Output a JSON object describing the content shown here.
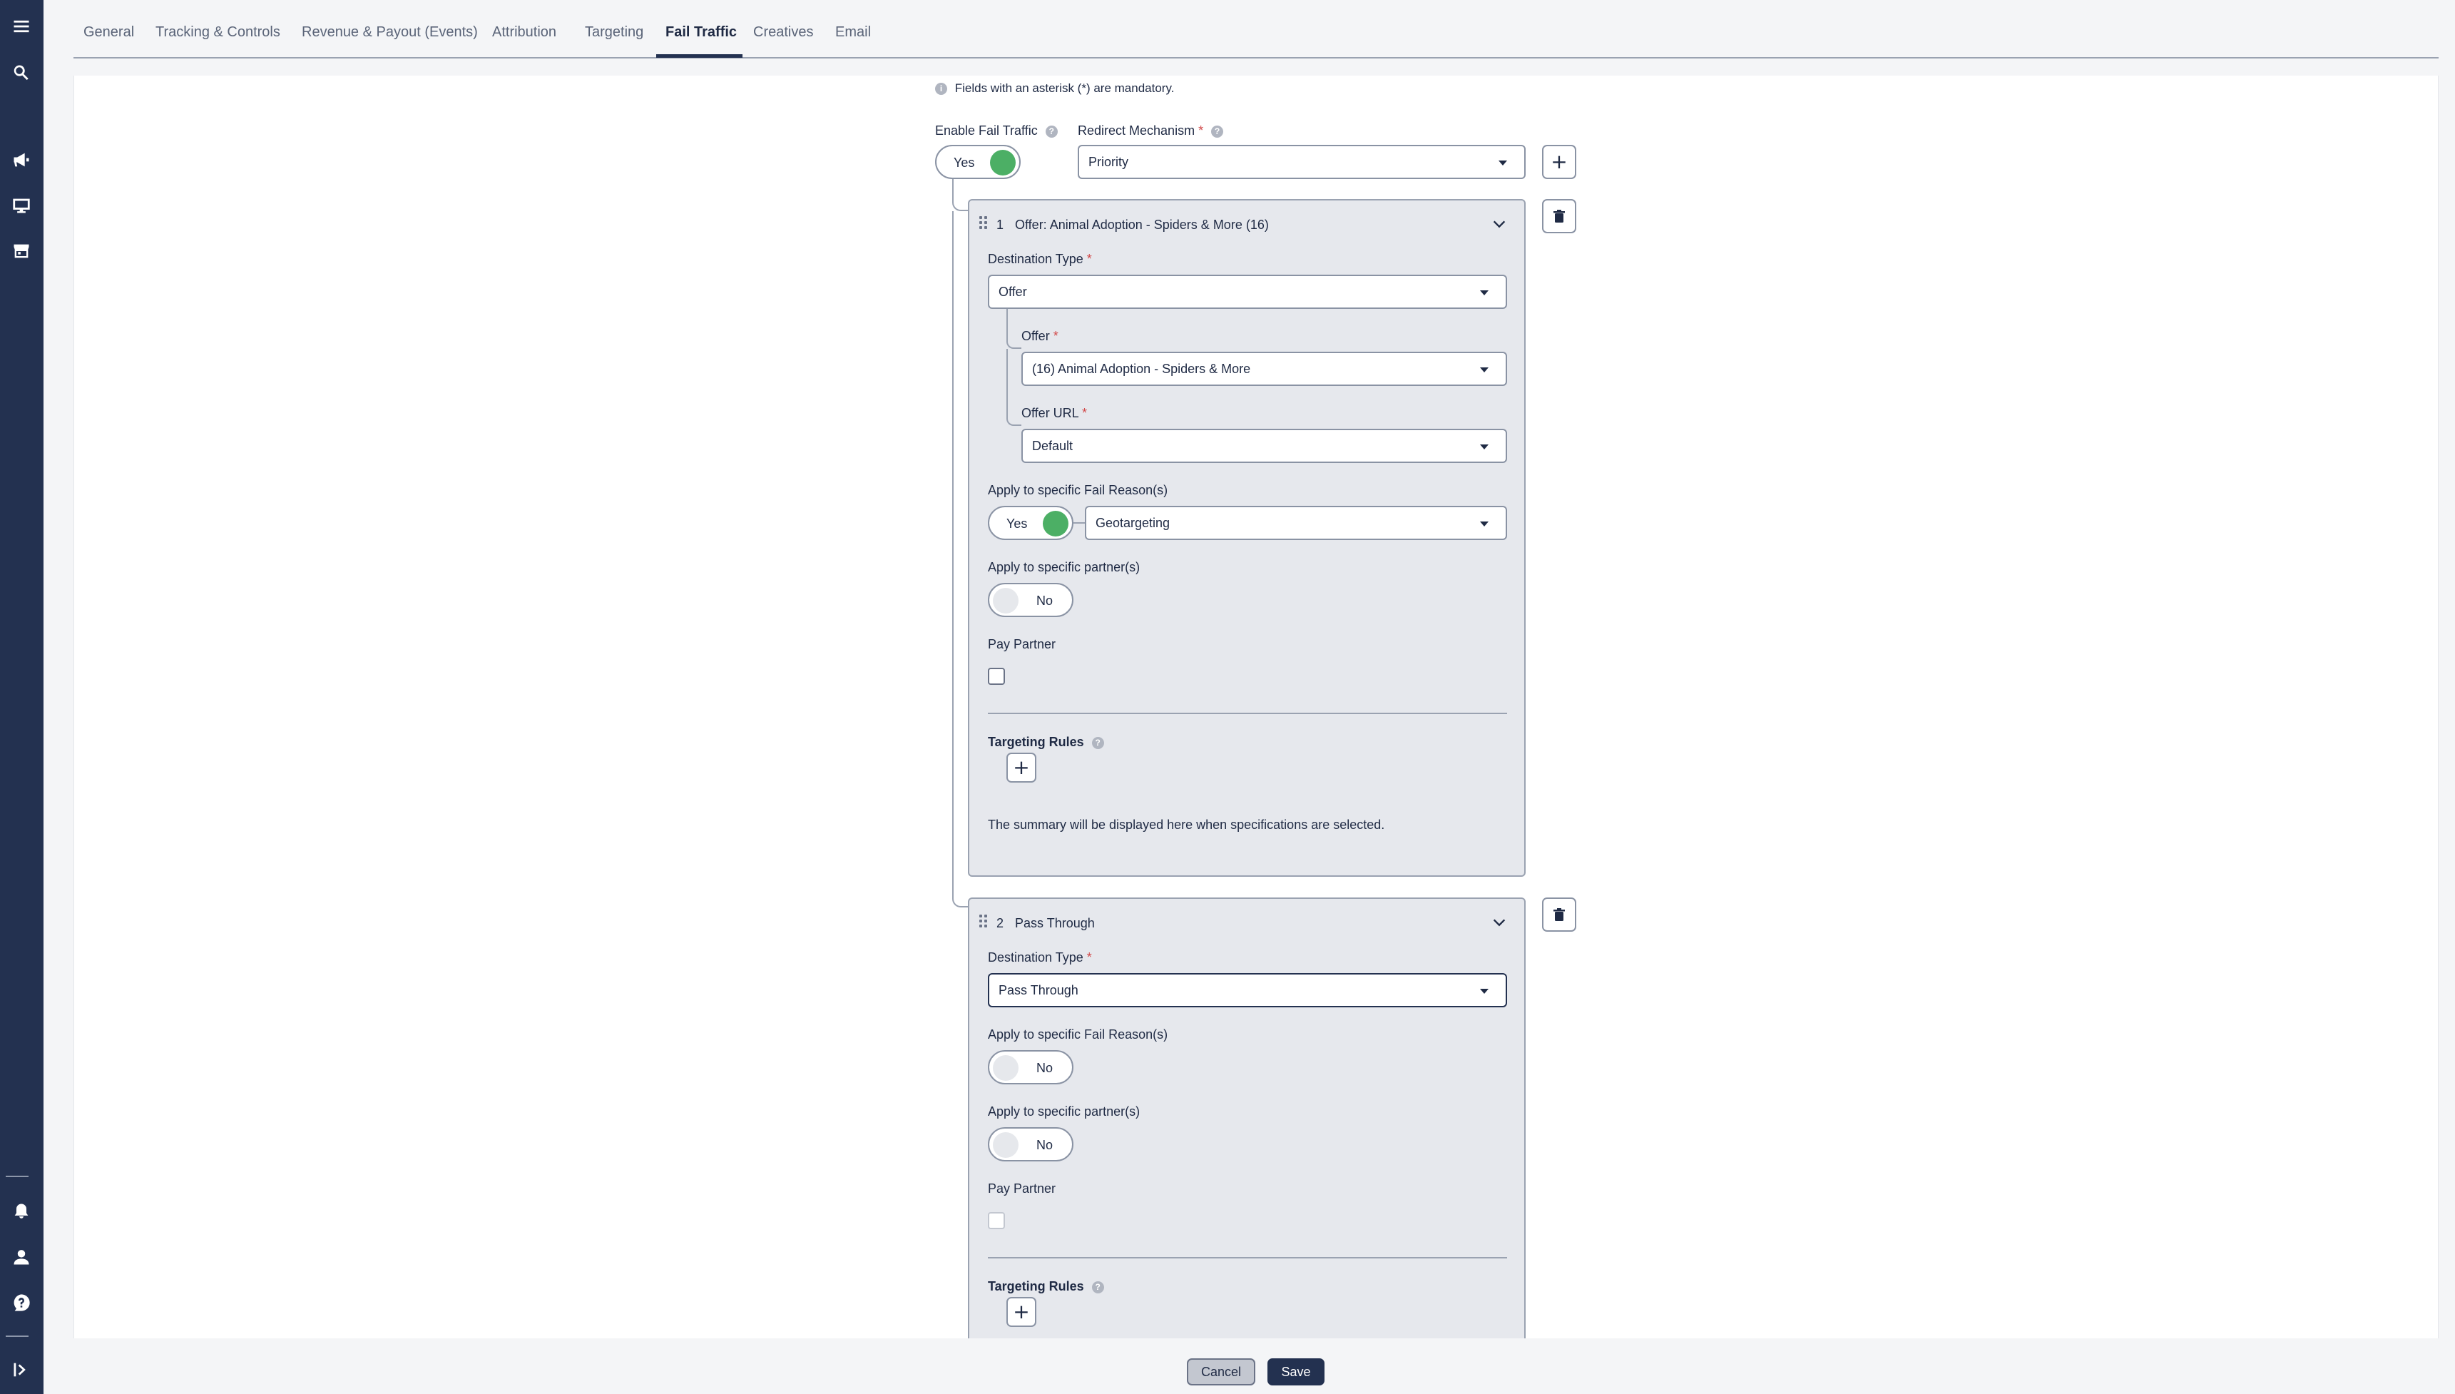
{
  "tabs": [
    {
      "label": "General"
    },
    {
      "label": "Tracking & Controls"
    },
    {
      "label": "Revenue & Payout (Events)"
    },
    {
      "label": "Attribution"
    },
    {
      "label": "Targeting"
    },
    {
      "label": "Fail Traffic",
      "active": true
    },
    {
      "label": "Creatives"
    },
    {
      "label": "Email"
    }
  ],
  "form": {
    "mandatory_note": "Fields with an asterisk (*) are mandatory.",
    "enable_fail_traffic": {
      "label": "Enable Fail Traffic",
      "value": "Yes"
    },
    "redirect_mechanism": {
      "label": "Redirect Mechanism",
      "value": "Priority"
    }
  },
  "rules": [
    {
      "index": "1",
      "title": "Offer: Animal Adoption - Spiders & More (16)",
      "destination_type": {
        "label": "Destination Type",
        "value": "Offer"
      },
      "offer": {
        "label": "Offer",
        "value": "(16) Animal Adoption - Spiders & More"
      },
      "offer_url": {
        "label": "Offer URL",
        "value": "Default"
      },
      "fail_reasons": {
        "label": "Apply to specific Fail Reason(s)",
        "toggle": "Yes",
        "value": "Geotargeting"
      },
      "partners": {
        "label": "Apply to specific partner(s)",
        "toggle": "No"
      },
      "pay_partner": {
        "label": "Pay Partner",
        "checked": false
      },
      "targeting_rules": {
        "label": "Targeting Rules"
      },
      "summary": "The summary will be displayed here when specifications are selected."
    },
    {
      "index": "2",
      "title": "Pass Through",
      "destination_type": {
        "label": "Destination Type",
        "value": "Pass Through"
      },
      "fail_reasons": {
        "label": "Apply to specific Fail Reason(s)",
        "toggle": "No"
      },
      "partners": {
        "label": "Apply to specific partner(s)",
        "toggle": "No"
      },
      "pay_partner": {
        "label": "Pay Partner",
        "checked": false,
        "disabled": true
      },
      "targeting_rules": {
        "label": "Targeting Rules"
      }
    }
  ],
  "footer": {
    "cancel": "Cancel",
    "save": "Save"
  },
  "colors": {
    "sidebar": "#233150",
    "toggle_on": "#4caf65",
    "required": "#d24a4a",
    "card_bg": "#e6e8ed"
  }
}
